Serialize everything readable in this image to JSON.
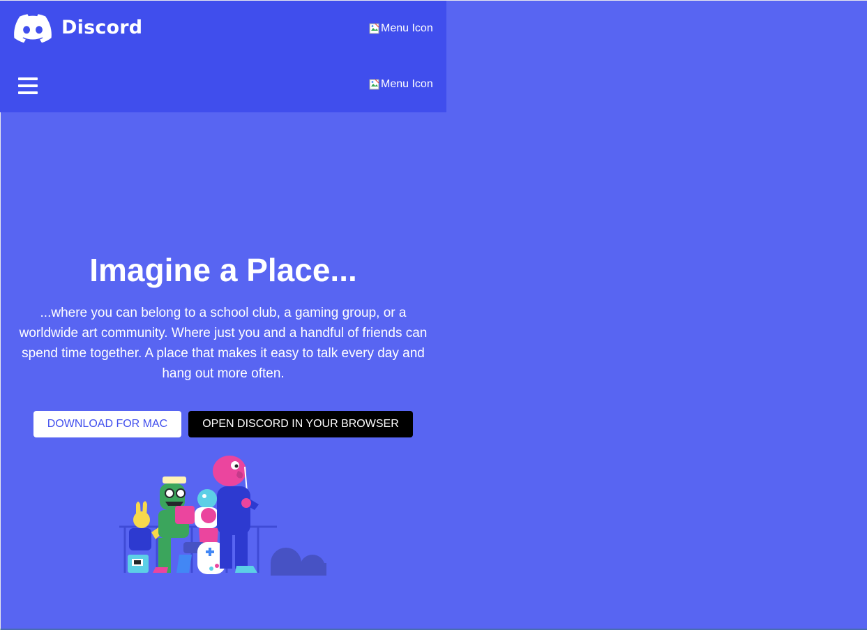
{
  "header": {
    "brand_name": "Discord",
    "menu_image_alt_top": "Menu Icon",
    "menu_image_alt_bottom": "Menu Icon"
  },
  "hero": {
    "title": "Imagine a Place...",
    "description": "...where you can belong to a school club, a gaming group, or a worldwide art community. Where just you and a handful of friends can spend time together. A place that makes it easy to talk every day and hang out more often."
  },
  "actions": {
    "download_label": "DOWNLOAD FOR MAC",
    "open_browser_label": "OPEN DISCORD IN YOUR BROWSER"
  },
  "icons": {
    "logo": "discord-logo-icon",
    "hamburger": "hamburger-menu-icon",
    "broken_image": "broken-image-icon"
  },
  "colors": {
    "page_background": "#5865f2",
    "header_background": "#404eed",
    "primary_text": "#ffffff",
    "download_button_bg": "#ffffff",
    "download_button_text": "#404eed",
    "open_button_bg": "#000000"
  }
}
